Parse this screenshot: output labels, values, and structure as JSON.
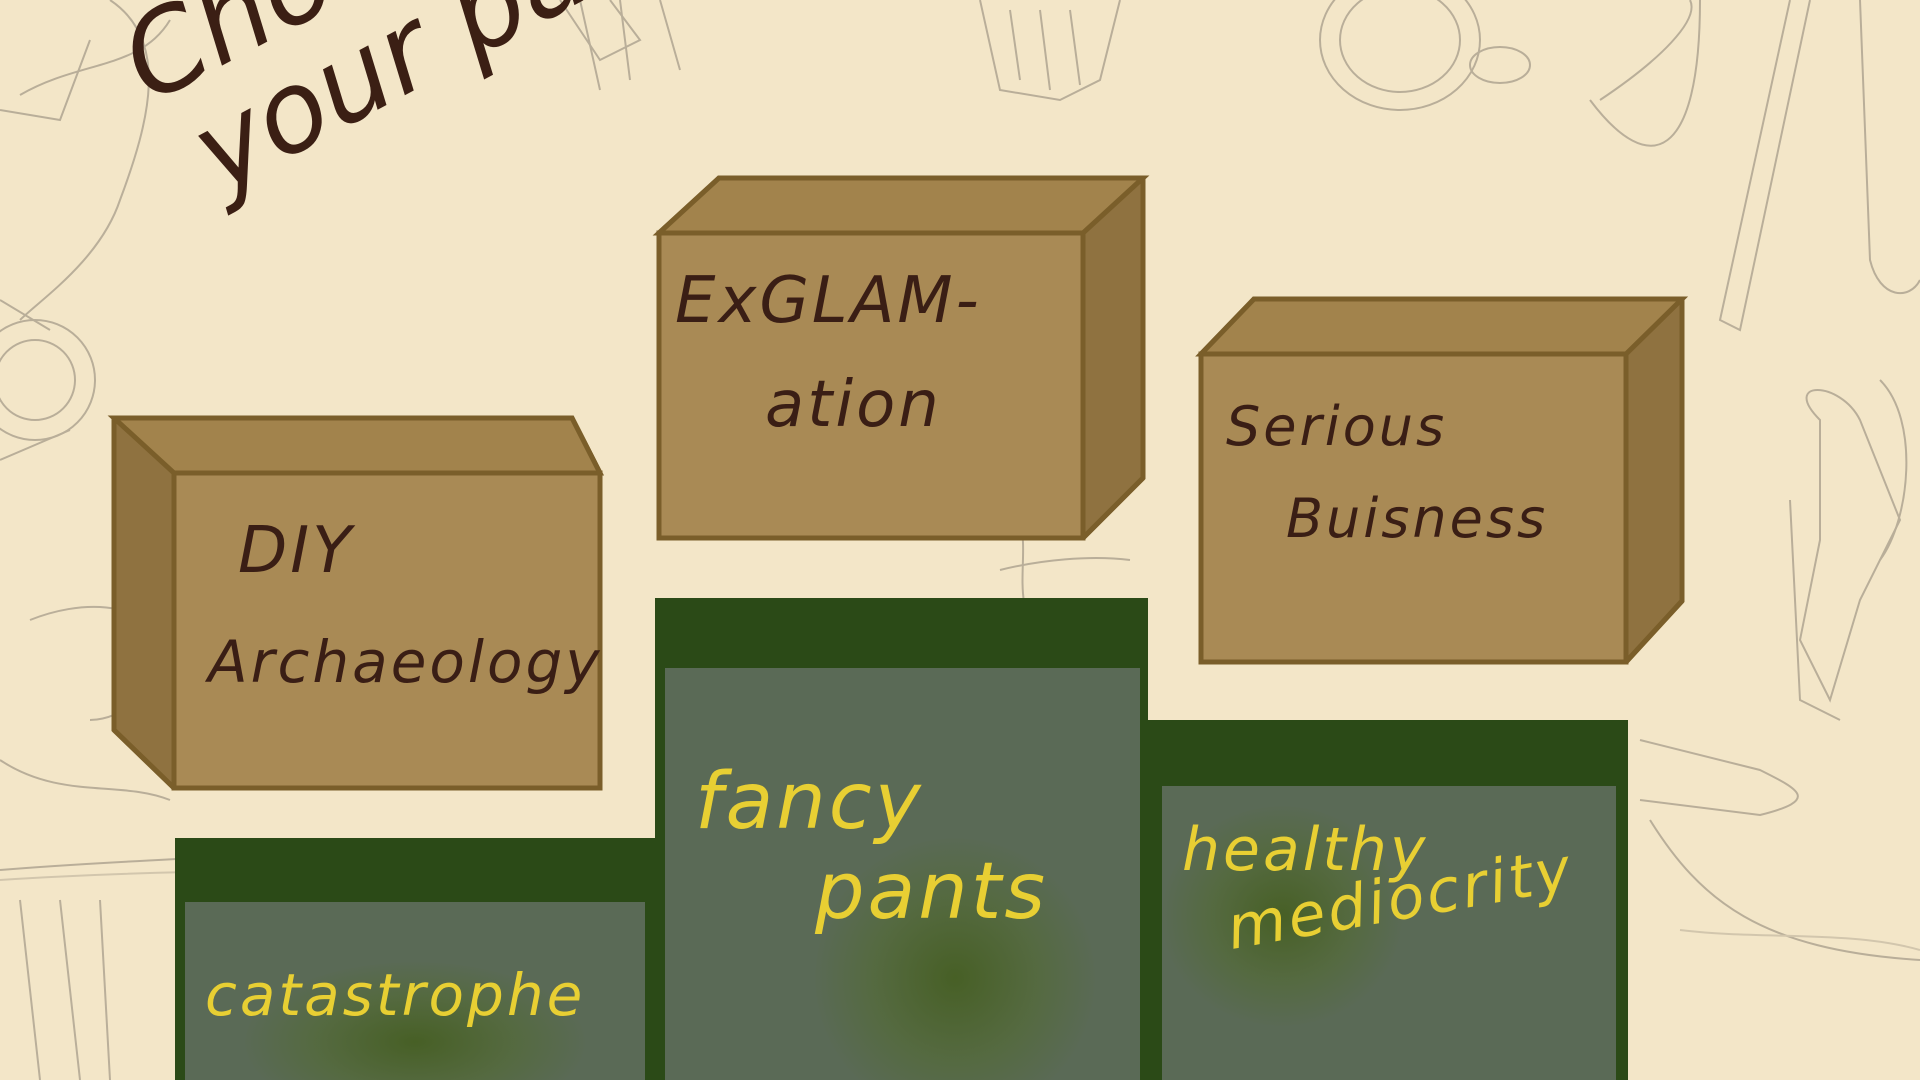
{
  "title": {
    "line1": "Choose",
    "line2": "your package!"
  },
  "packages": [
    {
      "name": "DIY",
      "name2": "Archaeology"
    },
    {
      "name": "ExGLAM-",
      "name2": "ation"
    },
    {
      "name": "Serious",
      "name2": "Buisness"
    }
  ],
  "podium": [
    {
      "label": "catastrophe",
      "label2": ""
    },
    {
      "label": "fancy",
      "label2": "pants"
    },
    {
      "label": "healthy",
      "label2": "mediocrity"
    }
  ],
  "colors": {
    "background": "#f3e6c8",
    "box_face": "#a98a55",
    "box_side": "#8f7240",
    "box_outline": "#7a5e2a",
    "podium_frame": "#2b4a17",
    "podium_panel": "#5a6a56",
    "podium_text": "#e8cf33",
    "ink": "#3b1f14"
  }
}
